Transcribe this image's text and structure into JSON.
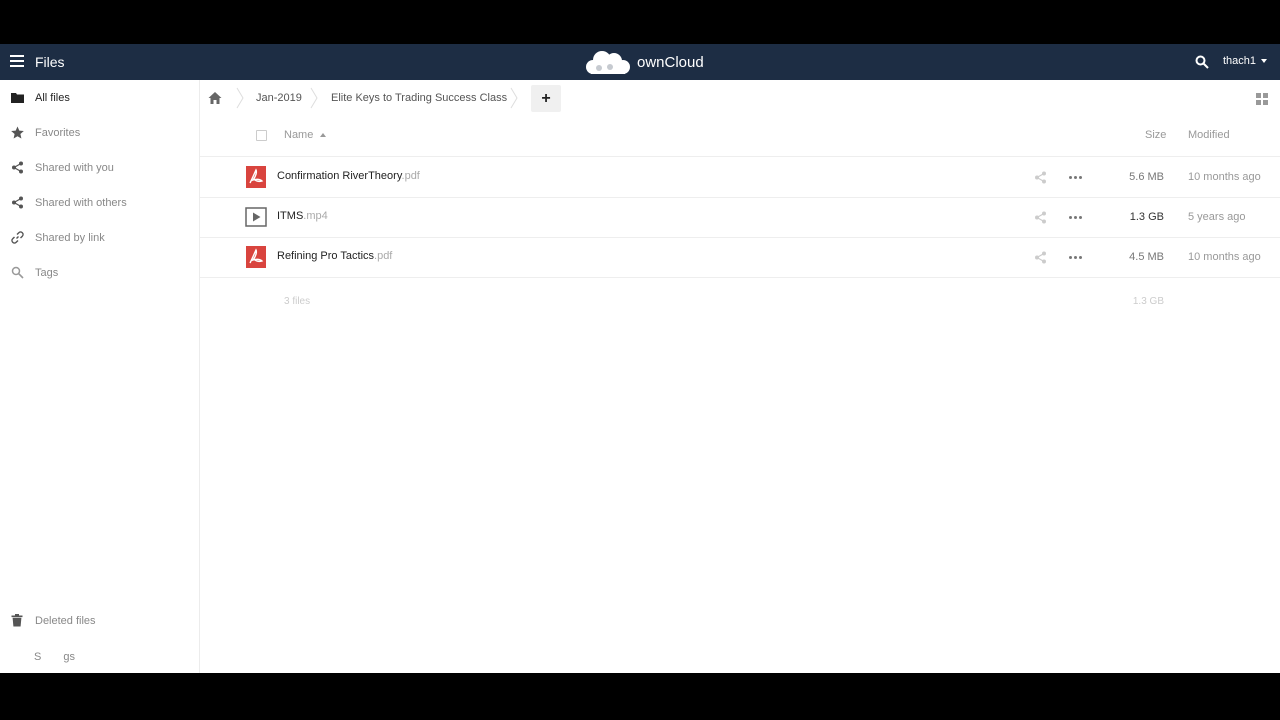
{
  "header": {
    "app_title": "Files",
    "brand_name": "ownCloud",
    "user": "thach1",
    "bg_color": "#1d2d44"
  },
  "sidebar": {
    "items": [
      {
        "label": "All files",
        "icon": "folder-icon"
      },
      {
        "label": "Favorites",
        "icon": "star-icon"
      },
      {
        "label": "Shared with you",
        "icon": "share-icon"
      },
      {
        "label": "Shared with others",
        "icon": "share-icon"
      },
      {
        "label": "Shared by link",
        "icon": "link-icon"
      },
      {
        "label": "Tags",
        "icon": "search-icon"
      }
    ],
    "deleted_files": "Deleted files",
    "settings_peek": "S",
    "settings_peek_end": "gs"
  },
  "breadcrumb": {
    "items": [
      "Jan-2019",
      "Elite Keys to Trading Success Class"
    ],
    "new_button": "+"
  },
  "file_list": {
    "columns": {
      "name": "Name",
      "size": "Size",
      "modified": "Modified"
    },
    "rows": [
      {
        "name": "Confirmation RiverTheory",
        "ext": ".pdf",
        "type": "pdf",
        "size": "5.6 MB",
        "modified": "10 months ago"
      },
      {
        "name": "ITMS",
        "ext": ".mp4",
        "type": "video",
        "size": "1.3 GB",
        "modified": "5 years ago"
      },
      {
        "name": "Refining Pro Tactics",
        "ext": ".pdf",
        "type": "pdf",
        "size": "4.5 MB",
        "modified": "10 months ago"
      }
    ],
    "summary": {
      "count": "3 files",
      "total": "1.3 GB"
    }
  },
  "colors": {
    "pdf_red": "#d9443e",
    "accept_green": "#2ecc71",
    "cancel_red": "#e74c3c"
  }
}
